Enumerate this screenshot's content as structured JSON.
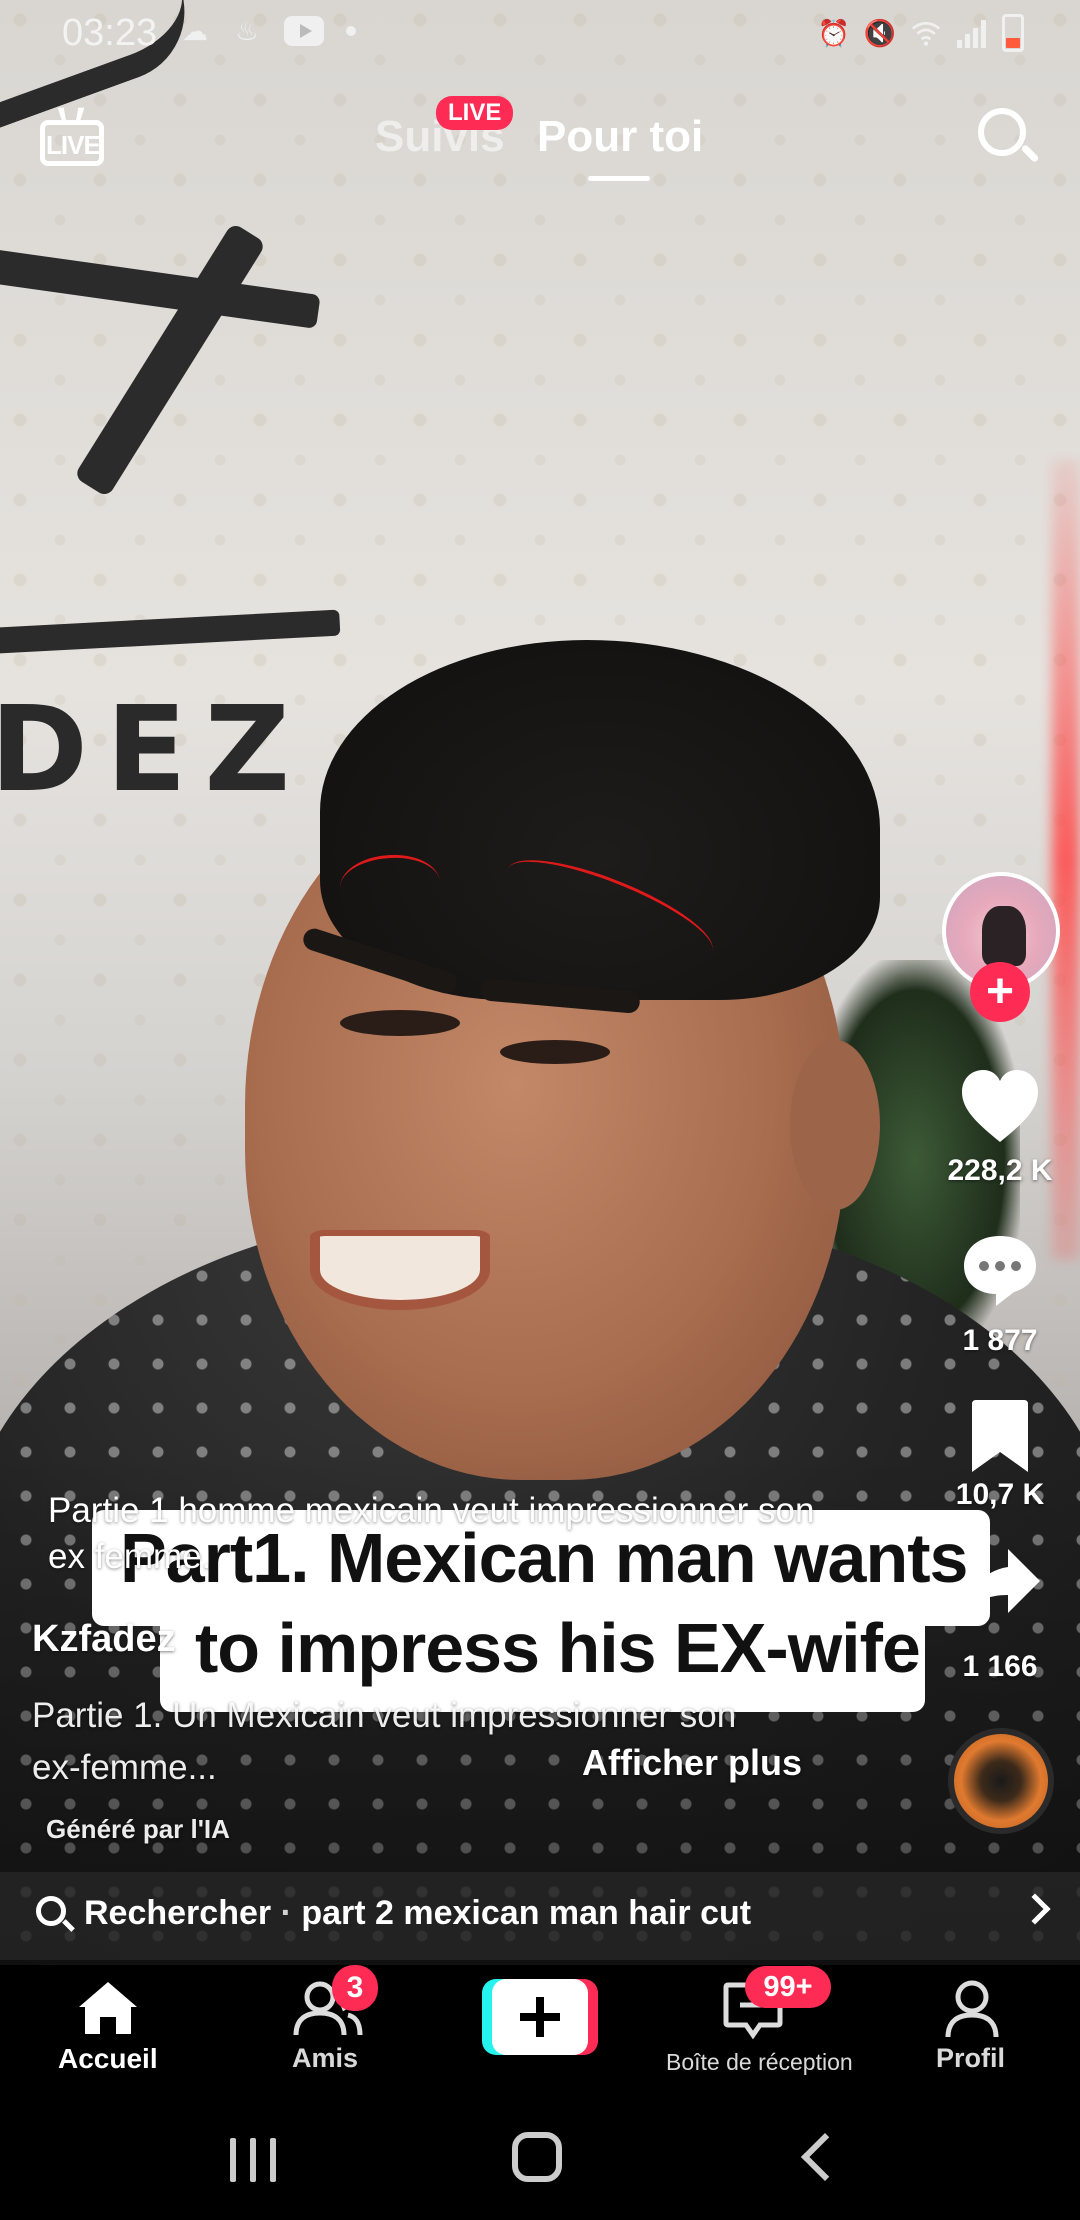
{
  "status_bar": {
    "time": "03:23",
    "notification_icons": [
      "cloud-icon",
      "thread-icon",
      "youtube-icon",
      "dot-icon"
    ],
    "system_icons": [
      "alarm-icon",
      "mute-icon",
      "wifi-icon",
      "signal-icon",
      "battery-icon"
    ]
  },
  "top_nav": {
    "live_icon_text": "LIVE",
    "following_label": "Suivis",
    "live_badge": "LIVE",
    "for_you_label": "Pour toi"
  },
  "video": {
    "background_sign_text": "DEZ",
    "overlay_text_line1": "Part1. Mexican man wants",
    "overlay_text_line2": "to impress his EX-wife",
    "translated_caption": "Partie 1 homme mexicain veut impressionner son ex femme."
  },
  "post": {
    "username": "Kzfadez",
    "description": "Partie 1. Un Mexicain veut impressionner son ex-femme...",
    "see_more": "Afficher plus",
    "ai_label": "Généré par l'IA"
  },
  "actions": {
    "likes": "228,2 K",
    "comments": "1 877",
    "bookmarks": "10,7 K",
    "shares": "1 166"
  },
  "search_bar": {
    "prefix": "Rechercher",
    "separator": "·",
    "query": "part 2 mexican man hair cut"
  },
  "bottom_nav": {
    "home": "Accueil",
    "friends": "Amis",
    "friends_badge": "3",
    "inbox": "Boîte de réception",
    "inbox_badge": "99+",
    "profile": "Profil"
  },
  "colors": {
    "accent_red": "#fe2c55",
    "accent_cyan": "#25f4ee"
  }
}
